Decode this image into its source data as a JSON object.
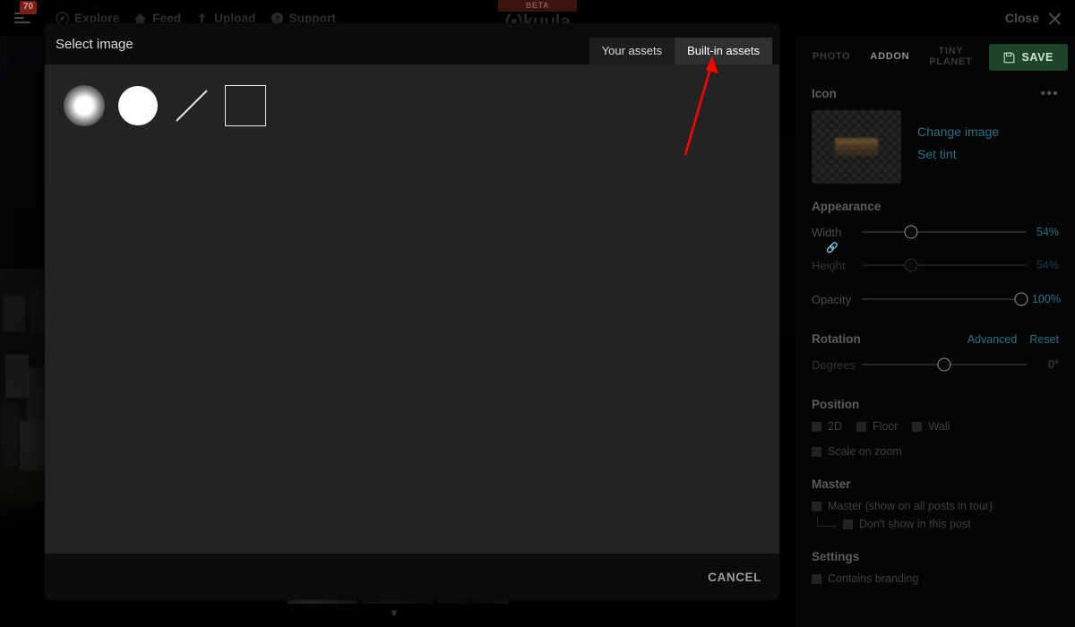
{
  "topnav": {
    "menu_badge": "70",
    "items": [
      {
        "label": "Explore",
        "icon": "compass-icon"
      },
      {
        "label": "Feed",
        "icon": "home-icon"
      },
      {
        "label": "Upload",
        "icon": "upload-arrow-icon"
      },
      {
        "label": "Support",
        "icon": "question-circle-icon"
      }
    ],
    "brand": {
      "beta_tag": "BETA",
      "name": "kuula",
      "logo_prefix": "(•)"
    },
    "close_label": "Close",
    "close_icon": "close-x-icon"
  },
  "modal": {
    "title": "Select image",
    "tabs": [
      {
        "label": "Your assets",
        "active": false
      },
      {
        "label": "Built-in assets",
        "active": true
      }
    ],
    "assets": [
      {
        "name": "soft-glow-circle-asset"
      },
      {
        "name": "solid-circle-asset"
      },
      {
        "name": "diagonal-line-asset"
      },
      {
        "name": "square-outline-asset"
      }
    ],
    "cancel_label": "CANCEL"
  },
  "annotation": {
    "type": "red-arrow",
    "color": "#ff0000",
    "points_to": "Built-in assets"
  },
  "sidepanel": {
    "tabs": [
      {
        "label": "PHOTO",
        "active": false
      },
      {
        "label": "ADDON",
        "active": true
      },
      {
        "label": "TINY\nPLANET",
        "active": false
      }
    ],
    "save_label": "SAVE",
    "save_icon": "floppy-disk-icon",
    "save_color": "#1d4428",
    "icon_section": {
      "title": "Icon",
      "overflow_icon": "more-dots-icon",
      "change_image_label": "Change image",
      "set_tint_label": "Set tint"
    },
    "appearance": {
      "title": "Appearance",
      "width": {
        "label": "Width",
        "value": "54%",
        "pos": 30
      },
      "link_icon": "chain-link-icon",
      "height": {
        "label": "Height",
        "value": "54%",
        "pos": 30
      },
      "opacity": {
        "label": "Opacity",
        "value": "100%",
        "pos": 98
      }
    },
    "rotation": {
      "title": "Rotation",
      "advanced_label": "Advanced",
      "reset_label": "Reset",
      "degrees": {
        "label": "Degrees",
        "value": "0°",
        "pos": 50
      }
    },
    "position": {
      "title": "Position",
      "options": [
        {
          "label": "2D",
          "checked": false
        },
        {
          "label": "Floor",
          "checked": false
        },
        {
          "label": "Wall",
          "checked": false
        }
      ],
      "scale_on_zoom": {
        "label": "Scale on zoom",
        "checked": false
      }
    },
    "master": {
      "title": "Master",
      "master_option": {
        "label": "Master (show on all posts in tour)",
        "checked": false
      },
      "nested_option": {
        "label": "Don't show in this post",
        "checked": false
      }
    },
    "settings": {
      "title": "Settings",
      "branding_option": {
        "label": "Contains branding",
        "checked": false
      }
    },
    "link_color": "#2c6f86"
  },
  "filmstrip": {
    "collapse_icon": "chevron-down-icon",
    "thumb_count": 3
  }
}
